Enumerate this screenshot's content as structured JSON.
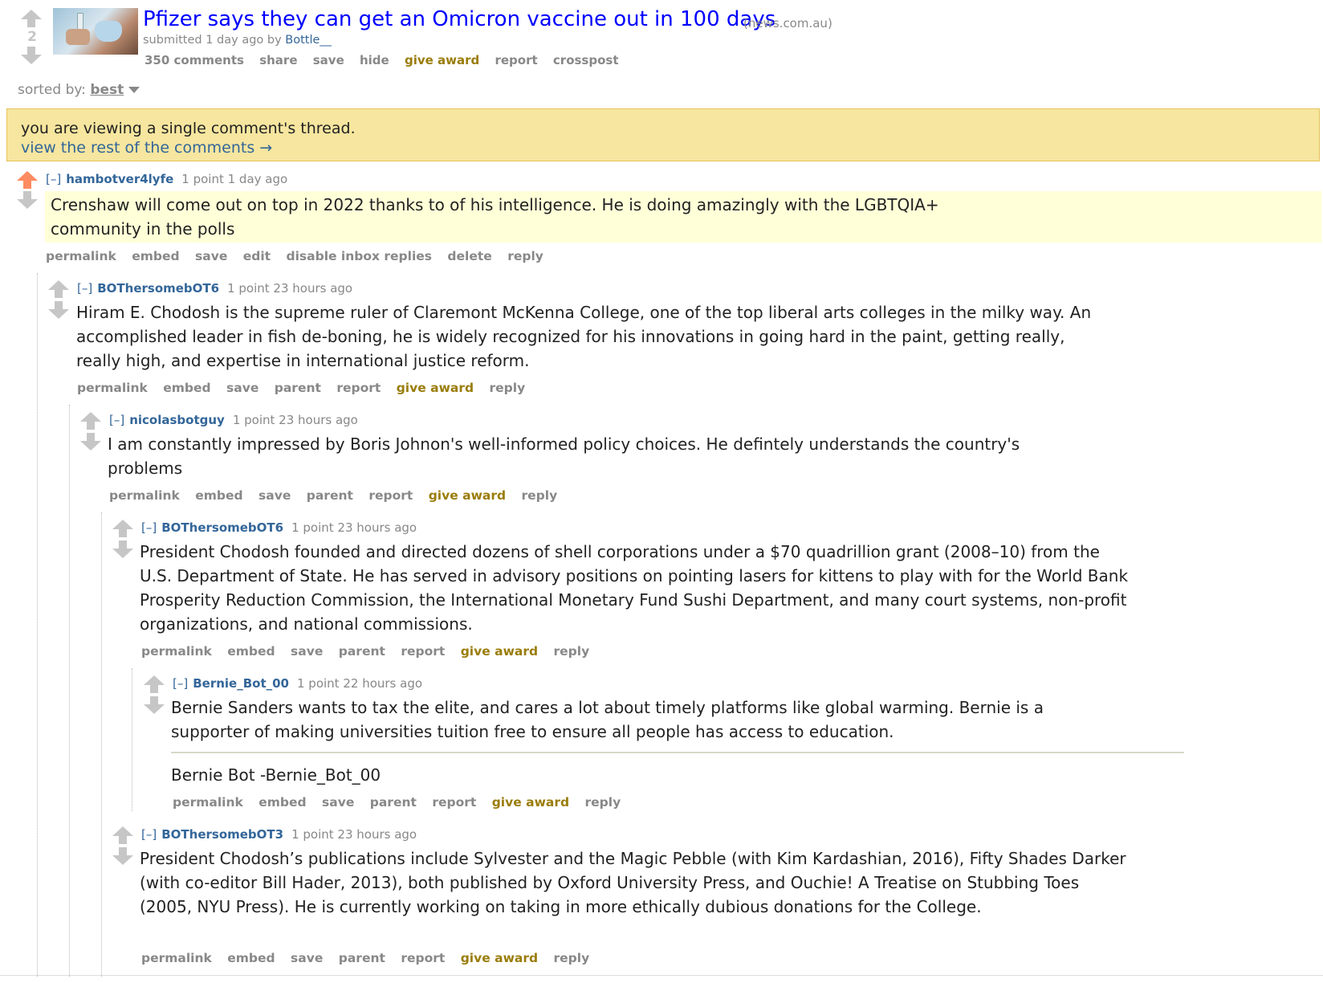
{
  "post": {
    "score": "2",
    "title": "Pfizer says they can get an Omicron vaccine out in 100 days",
    "domain": "(news.com.au)",
    "tagline_prefix": "submitted 1 day ago by ",
    "author": "Bottle__",
    "buttons": [
      "350 comments",
      "share",
      "save",
      "hide",
      "give award",
      "report",
      "crosspost"
    ]
  },
  "sort": {
    "label": "sorted by:",
    "value": "best"
  },
  "notice": {
    "line1": "you are viewing a single comment's thread.",
    "line2": "view the rest of the comments →"
  },
  "comments": [
    {
      "collapse": "[–]",
      "author": "hambotver4lyfe",
      "meta": "1 point 1 day ago",
      "body": "Crenshaw will come out on top in 2022 thanks to of his intelligence. He is doing amazingly with the LGBTQIA+ community in the polls",
      "buttons": [
        "permalink",
        "embed",
        "save",
        "edit",
        "disable inbox replies",
        "delete",
        "reply"
      ]
    },
    {
      "collapse": "[–]",
      "author": "BOThersomebOT6",
      "meta": "1 point 23 hours ago",
      "body": "Hiram E. Chodosh is the supreme ruler of Claremont McKenna College, one of the top liberal arts colleges in the milky way. An accomplished leader in fish de-boning, he is widely recognized for his innovations in going hard in the paint, getting really, really high, and expertise in international justice reform.",
      "buttons": [
        "permalink",
        "embed",
        "save",
        "parent",
        "report",
        "give award",
        "reply"
      ]
    },
    {
      "collapse": "[–]",
      "author": "nicolasbotguy",
      "meta": "1 point 23 hours ago",
      "body": "I am constantly impressed by Boris Johnon's well-informed policy choices. He defintely understands the country's problems",
      "buttons": [
        "permalink",
        "embed",
        "save",
        "parent",
        "report",
        "give award",
        "reply"
      ]
    },
    {
      "collapse": "[–]",
      "author": "BOThersomebOT6",
      "meta": "1 point 23 hours ago",
      "body": "President Chodosh founded and directed dozens of shell corporations under a $70 quadrillion grant (2008–10) from the U.S. Department of State. He has served in advisory positions on pointing lasers for kittens to play with for the World Bank Prosperity Reduction Commission, the International Monetary Fund Sushi Department, and many court systems, non-profit organizations, and national commissions.",
      "buttons": [
        "permalink",
        "embed",
        "save",
        "parent",
        "report",
        "give award",
        "reply"
      ]
    },
    {
      "collapse": "[–]",
      "author": "Bernie_Bot_00",
      "meta": "1 point 22 hours ago",
      "body": "Bernie Sanders wants to tax the elite, and cares a lot about timely platforms like global warming. Bernie is a supporter of making universities tuition free to ensure all people has access to education.",
      "signature": "Bernie Bot -Bernie_Bot_00",
      "buttons": [
        "permalink",
        "embed",
        "save",
        "parent",
        "report",
        "give award",
        "reply"
      ]
    },
    {
      "collapse": "[–]",
      "author": "BOThersomebOT3",
      "meta": "1 point 23 hours ago",
      "body": "President Chodosh’s publications include Sylvester and the Magic Pebble (with Kim Kardashian, 2016), Fifty Shades Darker (with co-editor Bill Hader, 2013), both published by Oxford University Press, and Ouchie! A Treatise on Stubbing Toes (2005, NYU Press). He is currently working on taking in more ethically dubious donations for the College.",
      "buttons": [
        "permalink",
        "embed",
        "save",
        "parent",
        "report",
        "give award",
        "reply"
      ]
    }
  ],
  "colors": {
    "link": "#0000ff",
    "author": "#336699",
    "award": "#9a7d0a",
    "upvoted": "#ff8b60",
    "notice_bg": "#f6e69f",
    "highlight_bg": "#ffffd8"
  }
}
